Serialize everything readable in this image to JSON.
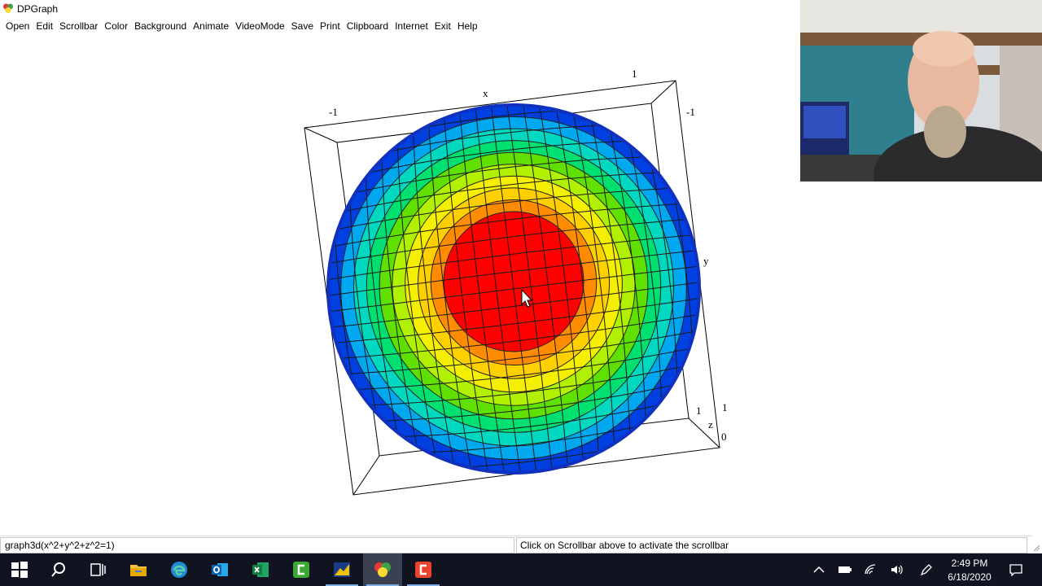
{
  "window": {
    "title": "DPGraph"
  },
  "menu": {
    "items": [
      "Open",
      "Edit",
      "Scrollbar",
      "Color",
      "Background",
      "Animate",
      "VideoMode",
      "Save",
      "Print",
      "Clipboard",
      "Internet",
      "Exit",
      "Help"
    ]
  },
  "graph": {
    "axis_labels": {
      "x_name": "x",
      "y_name": "y",
      "z_name": "z",
      "top_left_tick": "-1",
      "top_right_tick": "1",
      "right_top_tick": "-1",
      "bottom_right_1": "1",
      "bottom_right_2": "1",
      "bottom_right_0": "0"
    },
    "colors": {
      "bands": [
        "#ff0000",
        "#ff8c00",
        "#ffd000",
        "#f4ee00",
        "#b0f000",
        "#60e000",
        "#00e070",
        "#00d8c0",
        "#00a8f0",
        "#0040e0"
      ]
    }
  },
  "status": {
    "left_text": "graph3d(x^2+y^2+z^2=1)",
    "right_text": "Click on Scrollbar above to activate the scrollbar"
  },
  "taskbar": {
    "apps": [
      {
        "name": "start-button",
        "icon": "windows-icon"
      },
      {
        "name": "search-button",
        "icon": "search-icon"
      },
      {
        "name": "task-view-button",
        "icon": "task-view-icon"
      },
      {
        "name": "file-explorer-button",
        "icon": "folder-icon"
      },
      {
        "name": "edge-button",
        "icon": "edge-icon"
      },
      {
        "name": "outlook-button",
        "icon": "outlook-icon"
      },
      {
        "name": "excel-button",
        "icon": "excel-icon"
      },
      {
        "name": "camtasia-button",
        "icon": "camtasia-icon"
      },
      {
        "name": "dpgraph-taskbar-button",
        "icon": "dpgraph-icon"
      },
      {
        "name": "recorder-button",
        "icon": "recorder-icon"
      }
    ],
    "clock": {
      "time": "2:49 PM",
      "date": "6/18/2020"
    }
  }
}
